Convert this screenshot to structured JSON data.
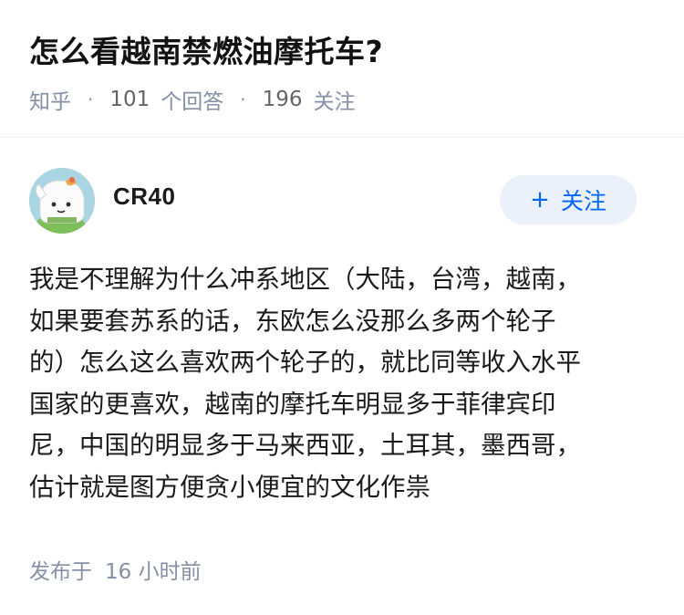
{
  "question": {
    "title": "怎么看越南禁燃油摩托车?",
    "source": "知乎",
    "answer_count": "101",
    "answer_label": "个回答",
    "follower_count": "196",
    "follower_label": "关注"
  },
  "author": {
    "name": "CR40",
    "follow_label": "关注",
    "plus_icon": "+"
  },
  "answer": {
    "lines": [
      "我是不理解为什么冲系地区（大陆，台湾，越南，",
      "如果要套苏系的话，东欧怎么没那么多两个轮子",
      "的）怎么这么喜欢两个轮子的，就比同等收入水平",
      "国家的更喜欢，越南的摩托车明显多于菲律宾印",
      "尼，中国的明显多于马来西亚，土耳其，墨西哥，",
      "估计就是图方便贪小便宜的文化作祟"
    ],
    "publish_label": "发布于",
    "publish_time": "16 小时前"
  },
  "colors": {
    "accent": "#0066ff",
    "follow_bg": "#ebf1fa",
    "meta": "#8590a6",
    "text": "#1a1a1a"
  }
}
